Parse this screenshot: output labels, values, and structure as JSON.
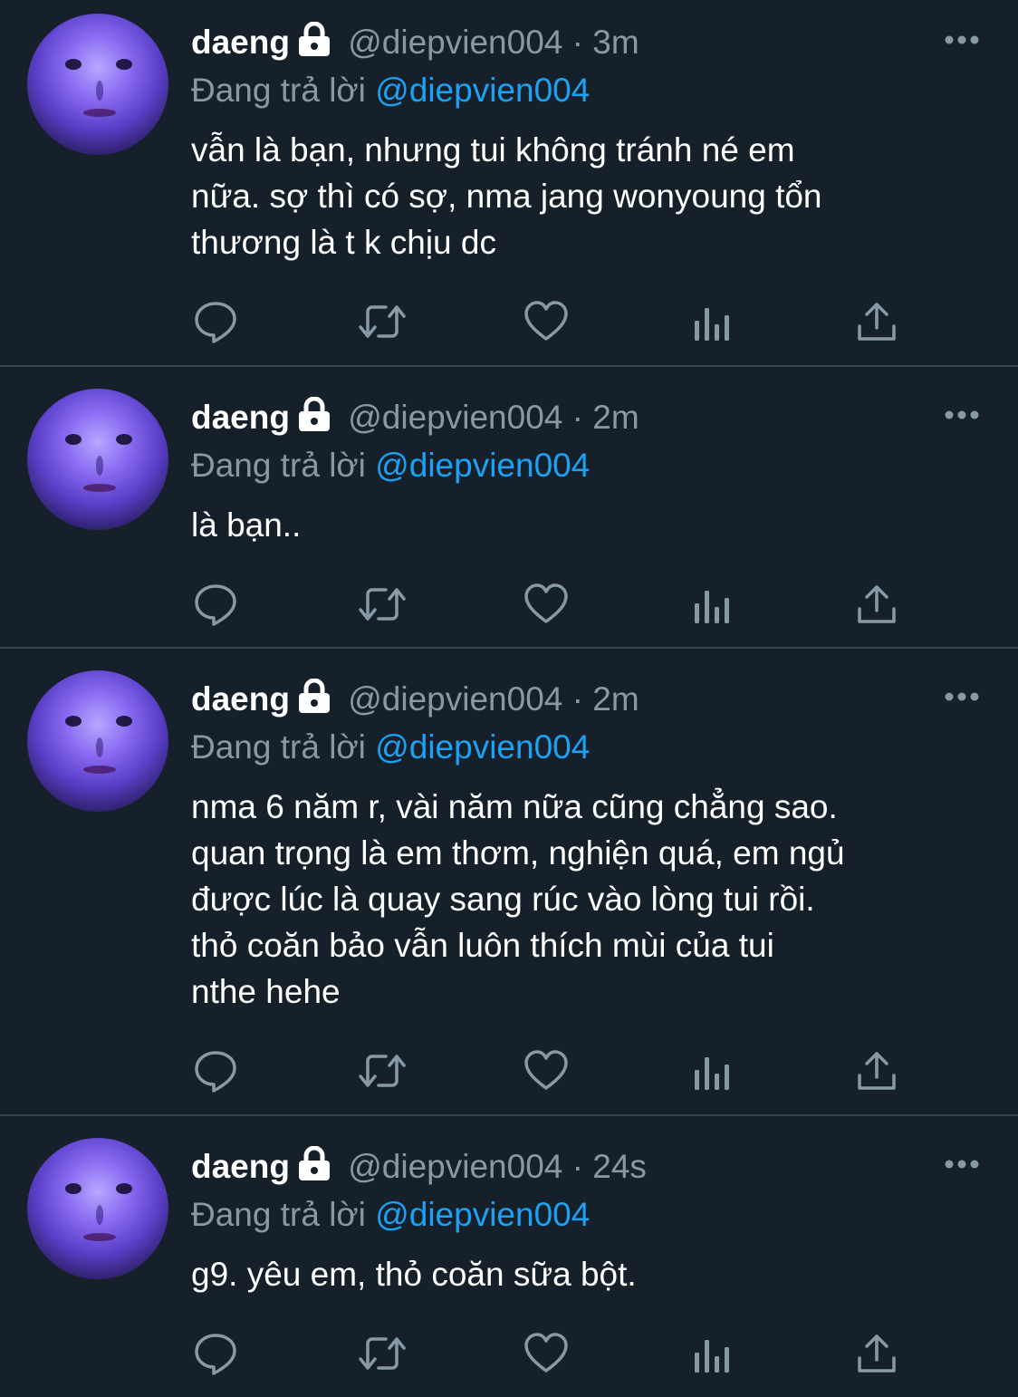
{
  "tweets": [
    {
      "display_name": "daeng",
      "handle": "@diepvien004",
      "separator": "·",
      "time": "3m",
      "reply_prefix": "Đang trả lời",
      "reply_to": "@diepvien004",
      "text": "vẫn là bạn, nhưng tui không tránh né em\nnữa. sợ thì có sợ, nma jang wonyoung tổn\nthương là t k chịu dc"
    },
    {
      "display_name": "daeng",
      "handle": "@diepvien004",
      "separator": "·",
      "time": "2m",
      "reply_prefix": "Đang trả lời",
      "reply_to": "@diepvien004",
      "text": "là bạn.."
    },
    {
      "display_name": "daeng",
      "handle": "@diepvien004",
      "separator": "·",
      "time": "2m",
      "reply_prefix": "Đang trả lời",
      "reply_to": "@diepvien004",
      "text": "nma 6 năm r, vài năm nữa cũng chẳng sao.\nquan trọng là em thơm, nghiện quá, em ngủ\nđược lúc là quay sang rúc vào lòng tui rồi.\nthỏ coăn bảo vẫn luôn thích mùi của tui\nnthe hehe"
    },
    {
      "display_name": "daeng",
      "handle": "@diepvien004",
      "separator": "·",
      "time": "24s",
      "reply_prefix": "Đang trả lời",
      "reply_to": "@diepvien004",
      "text": "g9. yêu em, thỏ coăn sữa bột."
    }
  ],
  "icons": {
    "lock": "lock-icon",
    "more": "more-options-icon",
    "reply": "reply-icon",
    "retweet": "retweet-icon",
    "like": "like-icon",
    "analytics": "analytics-icon",
    "share": "share-icon"
  },
  "colors": {
    "background": "#15202b",
    "primary_text": "#ffffff",
    "secondary_text": "#8899a6",
    "accent": "#1da1f2",
    "divider": "#38444d"
  }
}
